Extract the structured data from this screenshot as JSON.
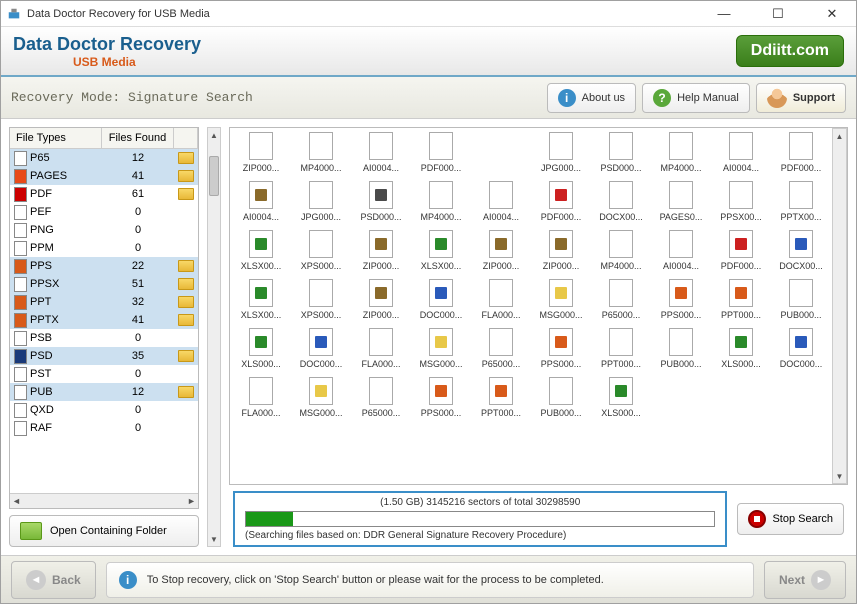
{
  "window": {
    "title": "Data Doctor Recovery for USB Media"
  },
  "banner": {
    "title": "Data Doctor Recovery",
    "subtitle": "USB Media",
    "brand": "Ddiitt.com"
  },
  "toolbar": {
    "mode_label": "Recovery Mode: Signature Search",
    "about": "About us",
    "help": "Help Manual",
    "support": "Support"
  },
  "file_types": {
    "header_type": "File Types",
    "header_count": "Files Found",
    "rows": [
      {
        "type": "P65",
        "count": 12,
        "hasFolder": true,
        "sel": true
      },
      {
        "type": "PAGES",
        "count": 41,
        "hasFolder": true,
        "sel": true,
        "iconColor": "#e84a1a"
      },
      {
        "type": "PDF",
        "count": 61,
        "hasFolder": true,
        "iconColor": "#cc0000"
      },
      {
        "type": "PEF",
        "count": 0
      },
      {
        "type": "PNG",
        "count": 0
      },
      {
        "type": "PPM",
        "count": 0
      },
      {
        "type": "PPS",
        "count": 22,
        "hasFolder": true,
        "sel": true,
        "iconColor": "#d85a1a"
      },
      {
        "type": "PPSX",
        "count": 51,
        "hasFolder": true,
        "sel": true
      },
      {
        "type": "PPT",
        "count": 32,
        "hasFolder": true,
        "sel": true,
        "iconColor": "#d85a1a"
      },
      {
        "type": "PPTX",
        "count": 41,
        "hasFolder": true,
        "sel": true,
        "iconColor": "#d85a1a"
      },
      {
        "type": "PSB",
        "count": 0
      },
      {
        "type": "PSD",
        "count": 35,
        "hasFolder": true,
        "sel": true,
        "iconColor": "#1a3a7a"
      },
      {
        "type": "PST",
        "count": 0
      },
      {
        "type": "PUB",
        "count": 12,
        "hasFolder": true,
        "sel": true
      },
      {
        "type": "QXD",
        "count": 0
      },
      {
        "type": "RAF",
        "count": 0
      }
    ]
  },
  "open_folder_label": "Open Containing Folder",
  "grid": [
    [
      "ZIP000...",
      "MP4000...",
      "AI0004...",
      "PDF000...",
      "",
      "JPG000...",
      "PSD000...",
      "MP4000...",
      "AI0004...",
      "PDF000..."
    ],
    [
      "AI0004...",
      "JPG000...",
      "PSD000...",
      "MP4000...",
      "AI0004...",
      "PDF000...",
      "DOCX00...",
      "PAGES0...",
      "PPSX00...",
      "PPTX00..."
    ],
    [
      "XLSX00...",
      "XPS000...",
      "ZIP000...",
      "XLSX00...",
      "ZIP000...",
      "ZIP000...",
      "MP4000...",
      "AI0004...",
      "PDF000...",
      "DOCX00..."
    ],
    [
      "XLSX00...",
      "XPS000...",
      "ZIP000...",
      "DOC000...",
      "FLA000...",
      "MSG000...",
      "P65000...",
      "PPS000...",
      "PPT000...",
      "PUB000..."
    ],
    [
      "XLS000...",
      "DOC000...",
      "FLA000...",
      "MSG000...",
      "P65000...",
      "PPS000...",
      "PPT000...",
      "PUB000...",
      "XLS000...",
      "DOC000..."
    ],
    [
      "FLA000...",
      "MSG000...",
      "P65000...",
      "PPS000...",
      "PPT000...",
      "PUB000...",
      "XLS000...",
      "",
      "",
      ""
    ]
  ],
  "grid_icons": [
    [
      "",
      "",
      "",
      "",
      "",
      "",
      "",
      "",
      "",
      ""
    ],
    [
      "zip",
      "",
      "ps",
      "",
      "",
      "pdf",
      "",
      "chrome",
      "",
      ""
    ],
    [
      "xls",
      "",
      "zip",
      "xls",
      "zip",
      "zip",
      "",
      "",
      "pdf",
      "doc"
    ],
    [
      "xls",
      "",
      "zip",
      "doc",
      "",
      "msg",
      "",
      "ppt",
      "ppt",
      ""
    ],
    [
      "xls",
      "doc",
      "",
      "msg",
      "",
      "ppt",
      "",
      "",
      "xls",
      "doc"
    ],
    [
      "",
      "msg",
      "",
      "ppt",
      "ppt",
      "",
      "xls",
      "",
      "",
      ""
    ]
  ],
  "progress": {
    "top": "(1.50 GB) 3145216  sectors  of  total 30298590",
    "bottom": "(Searching files based on:  DDR General Signature Recovery Procedure)",
    "percent": 10
  },
  "stop_label": "Stop Search",
  "footer": {
    "back": "Back",
    "next": "Next",
    "message": "To Stop recovery, click on 'Stop Search' button or please wait for the process to be completed."
  }
}
